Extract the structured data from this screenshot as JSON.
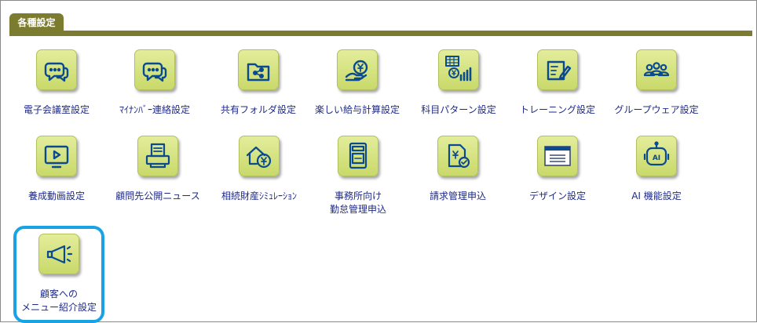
{
  "header": {
    "tab_label": "各種設定"
  },
  "colors": {
    "tab_bar": "#7c7c30",
    "icon_fill": "#d6e27f",
    "icon_stroke": "#0a4b8f",
    "label": "#1e2a88",
    "highlight": "#1aa3e4"
  },
  "settings": [
    {
      "icon": "chat-bubble-icon",
      "label": "電子会議室設定"
    },
    {
      "icon": "chat-bubble-icon",
      "label": "ﾏｲﾅﾝﾊﾞｰ連絡設定"
    },
    {
      "icon": "shared-folder-icon",
      "label": "共有フォルダ設定"
    },
    {
      "icon": "salary-calculation-icon",
      "label": "楽しい給与計算設定"
    },
    {
      "icon": "account-pattern-icon",
      "label": "科目パターン設定"
    },
    {
      "icon": "training-icon",
      "label": "トレーニング設定"
    },
    {
      "icon": "groupware-icon",
      "label": "グループウェア設定"
    },
    {
      "icon": "video-icon",
      "label": "養成動画設定"
    },
    {
      "icon": "news-printer-icon",
      "label": "顧問先公開ニュース"
    },
    {
      "icon": "inheritance-icon",
      "label": "相続財産ｼﾐｭﾚｰｼｮﾝ"
    },
    {
      "icon": "attendance-icon",
      "label": "事務所向け",
      "label2": "勤怠管理申込"
    },
    {
      "icon": "billing-icon",
      "label": "請求管理申込"
    },
    {
      "icon": "design-window-icon",
      "label": "デザイン設定"
    },
    {
      "icon": "ai-robot-icon",
      "label": "AI 機能設定"
    },
    {
      "icon": "megaphone-icon",
      "label": "顧客への",
      "label2": "メニュー紹介設定",
      "highlighted": true
    }
  ]
}
